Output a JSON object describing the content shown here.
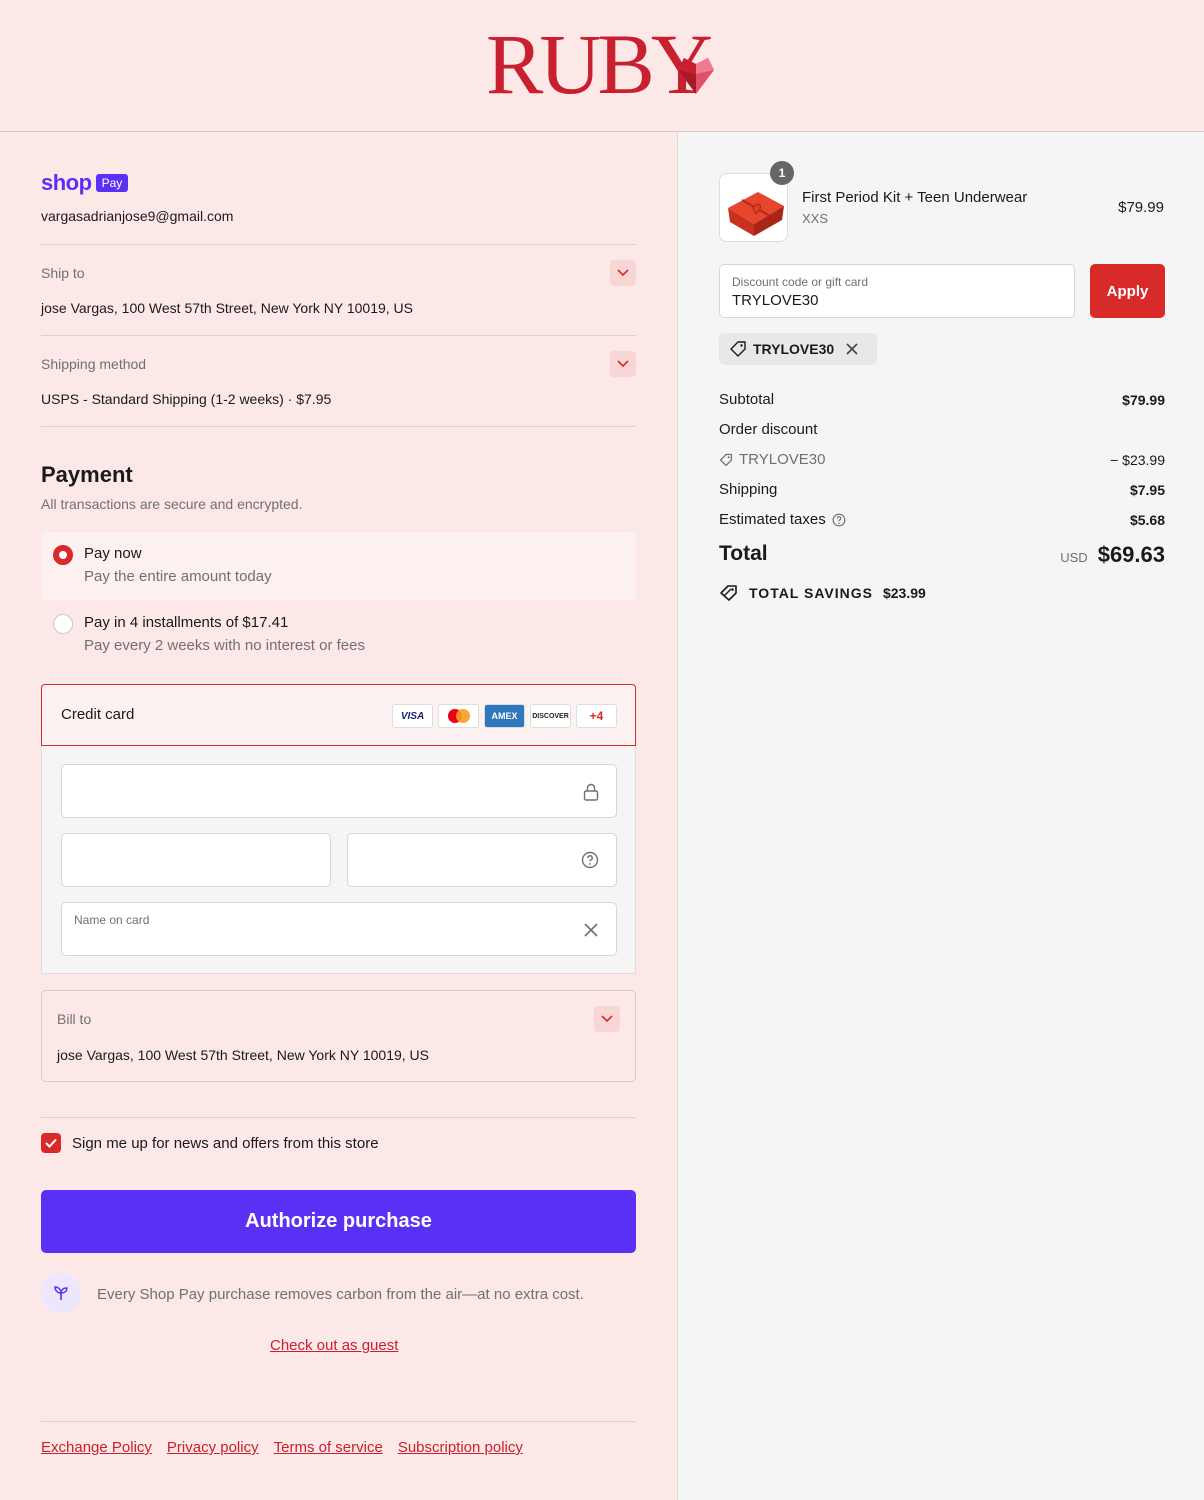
{
  "brand": {
    "name": "RUBY"
  },
  "shop_pay": {
    "word": "shop",
    "pill": "Pay",
    "email": "vargasadrianjose9@gmail.com"
  },
  "ship_to": {
    "label": "Ship to",
    "value": "jose Vargas, 100 West 57th Street, New York NY 10019, US"
  },
  "shipping_method": {
    "label": "Shipping method",
    "value": "USPS - Standard Shipping (1-2 weeks) · $7.95"
  },
  "payment": {
    "title": "Payment",
    "subtitle": "All transactions are secure and encrypted.",
    "options": [
      {
        "title": "Pay now",
        "subtitle": "Pay the entire amount today",
        "selected": true
      },
      {
        "title": "Pay in 4 installments of $17.41",
        "subtitle": "Pay every 2 weeks with no interest or fees",
        "selected": false
      }
    ],
    "credit_card": {
      "label": "Credit card",
      "badges": [
        "VISA",
        "",
        "AMEX",
        "DISCOVER",
        "+4"
      ],
      "name_on_card_label": "Name on card"
    }
  },
  "bill_to": {
    "label": "Bill to",
    "value": "jose Vargas, 100 West 57th Street, New York NY 10019, US"
  },
  "newsletter": {
    "label": "Sign me up for news and offers from this store",
    "checked": true
  },
  "authorize_label": "Authorize purchase",
  "carbon_text": "Every Shop Pay purchase removes carbon from the air—at no extra cost.",
  "guest_link": "Check out as guest",
  "footer_links": [
    "Exchange Policy",
    "Privacy policy",
    "Terms of service",
    "Subscription policy"
  ],
  "order": {
    "item": {
      "qty": "1",
      "name": "First Period Kit + Teen Underwear",
      "variant": "XXS",
      "price": "$79.99"
    },
    "discount": {
      "placeholder": "Discount code or gift card",
      "value": "TRYLOVE30",
      "apply_label": "Apply",
      "chip": "TRYLOVE30"
    },
    "summary": {
      "subtotal_label": "Subtotal",
      "subtotal": "$79.99",
      "order_discount_label": "Order discount",
      "discount_code": "TRYLOVE30",
      "discount_amount": "− $23.99",
      "shipping_label": "Shipping",
      "shipping": "$7.95",
      "taxes_label": "Estimated taxes",
      "taxes": "$5.68",
      "total_label": "Total",
      "currency": "USD",
      "total": "$69.63",
      "savings_label": "TOTAL SAVINGS",
      "savings": "$23.99"
    }
  },
  "colors": {
    "accent": "#d92a2a",
    "shop_purple": "#5a31f4",
    "bg_pink": "#fde8e8"
  }
}
